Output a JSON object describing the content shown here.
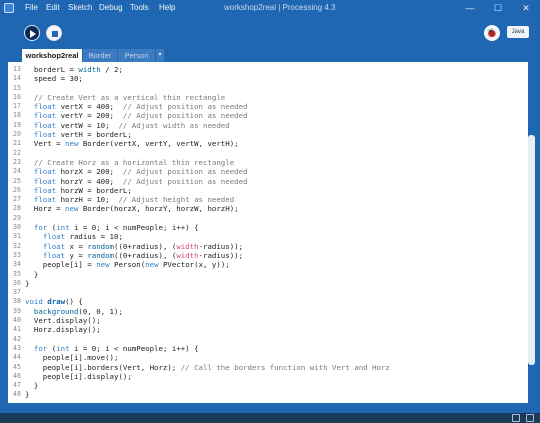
{
  "window": {
    "title": "workshop2real | Processing 4.3",
    "menu": [
      "File",
      "Edit",
      "Sketch",
      "Debug",
      "Tools",
      "Help"
    ],
    "controls": {
      "minimize": "—",
      "maximize": "☐",
      "close": "✕"
    }
  },
  "toolbar": {
    "mode": "Java",
    "debug_glyph": "🐞"
  },
  "tabs": [
    "workshop2real",
    "Border",
    "Person"
  ],
  "tab_menu_glyph": "▾",
  "editor": {
    "lines": [
      {
        "n": "13",
        "segs": [
          [
            "t",
            "  borderL = "
          ],
          [
            "f",
            "width"
          ],
          [
            "t",
            " / 2;"
          ]
        ]
      },
      {
        "n": "14",
        "segs": [
          [
            "t",
            "  speed = 30;"
          ]
        ]
      },
      {
        "n": "15",
        "segs": []
      },
      {
        "n": "16",
        "segs": [
          [
            "c",
            "  // Create Vert as a vertical thin rectangle"
          ]
        ]
      },
      {
        "n": "17",
        "segs": [
          [
            "t",
            "  "
          ],
          [
            "k",
            "float"
          ],
          [
            "t",
            " vertX = 400;  "
          ],
          [
            "c",
            "// Adjust position as needed"
          ]
        ]
      },
      {
        "n": "18",
        "segs": [
          [
            "t",
            "  "
          ],
          [
            "k",
            "float"
          ],
          [
            "t",
            " vertY = 200;  "
          ],
          [
            "c",
            "// Adjust position as needed"
          ]
        ]
      },
      {
        "n": "19",
        "segs": [
          [
            "t",
            "  "
          ],
          [
            "k",
            "float"
          ],
          [
            "t",
            " vertW = 10;  "
          ],
          [
            "c",
            "// Adjust width as needed"
          ]
        ]
      },
      {
        "n": "20",
        "segs": [
          [
            "t",
            "  "
          ],
          [
            "k",
            "float"
          ],
          [
            "t",
            " vertH = borderL;"
          ]
        ]
      },
      {
        "n": "21",
        "segs": [
          [
            "t",
            "  Vert = "
          ],
          [
            "k",
            "new"
          ],
          [
            "t",
            " Border(vertX, vertY, vertW, vertH);"
          ]
        ]
      },
      {
        "n": "22",
        "segs": []
      },
      {
        "n": "23",
        "segs": [
          [
            "c",
            "  // Create Horz as a horizontal thin rectangle"
          ]
        ]
      },
      {
        "n": "24",
        "segs": [
          [
            "t",
            "  "
          ],
          [
            "k",
            "float"
          ],
          [
            "t",
            " horzX = 200;  "
          ],
          [
            "c",
            "// Adjust position as needed"
          ]
        ]
      },
      {
        "n": "25",
        "segs": [
          [
            "t",
            "  "
          ],
          [
            "k",
            "float"
          ],
          [
            "t",
            " horzY = 400;  "
          ],
          [
            "c",
            "// Adjust position as needed"
          ]
        ]
      },
      {
        "n": "26",
        "segs": [
          [
            "t",
            "  "
          ],
          [
            "k",
            "float"
          ],
          [
            "t",
            " horzW = borderL;"
          ]
        ]
      },
      {
        "n": "27",
        "segs": [
          [
            "t",
            "  "
          ],
          [
            "k",
            "float"
          ],
          [
            "t",
            " horzH = 10;  "
          ],
          [
            "c",
            "// Adjust height as needed"
          ]
        ]
      },
      {
        "n": "28",
        "segs": [
          [
            "t",
            "  Horz = "
          ],
          [
            "k",
            "new"
          ],
          [
            "t",
            " Border(horzX, horzY, horzW, horzH);"
          ]
        ]
      },
      {
        "n": "29",
        "segs": []
      },
      {
        "n": "30",
        "segs": [
          [
            "t",
            "  "
          ],
          [
            "k",
            "for"
          ],
          [
            "t",
            " ("
          ],
          [
            "k",
            "int"
          ],
          [
            "t",
            " i = 0; i < numPeople; i++) {"
          ]
        ]
      },
      {
        "n": "31",
        "segs": [
          [
            "t",
            "    "
          ],
          [
            "k",
            "float"
          ],
          [
            "t",
            " radius = 10;"
          ]
        ]
      },
      {
        "n": "32",
        "segs": [
          [
            "t",
            "    "
          ],
          [
            "k",
            "float"
          ],
          [
            "t",
            " x = "
          ],
          [
            "f",
            "random"
          ],
          [
            "t",
            "((0+radius), ("
          ],
          [
            "v",
            "width"
          ],
          [
            "t",
            "-radius));"
          ]
        ]
      },
      {
        "n": "33",
        "segs": [
          [
            "t",
            "    "
          ],
          [
            "k",
            "float"
          ],
          [
            "t",
            " y = "
          ],
          [
            "f",
            "random"
          ],
          [
            "t",
            "((0+radius), ("
          ],
          [
            "v",
            "width"
          ],
          [
            "t",
            "-radius));"
          ]
        ]
      },
      {
        "n": "34",
        "segs": [
          [
            "t",
            "    people[i] = "
          ],
          [
            "k",
            "new"
          ],
          [
            "t",
            " Person("
          ],
          [
            "k",
            "new"
          ],
          [
            "t",
            " PVector(x, y));"
          ]
        ]
      },
      {
        "n": "35",
        "segs": [
          [
            "t",
            "  }"
          ]
        ]
      },
      {
        "n": "36",
        "segs": [
          [
            "t",
            "}"
          ]
        ]
      },
      {
        "n": "37",
        "segs": []
      },
      {
        "n": "38",
        "segs": [
          [
            "k",
            "void"
          ],
          [
            "t",
            " "
          ],
          [
            "b",
            "draw"
          ],
          [
            "t",
            "() {"
          ]
        ]
      },
      {
        "n": "39",
        "segs": [
          [
            "t",
            "  "
          ],
          [
            "f",
            "background"
          ],
          [
            "t",
            "(0, 0, 1);"
          ]
        ]
      },
      {
        "n": "40",
        "segs": [
          [
            "t",
            "  Vert.display();"
          ]
        ]
      },
      {
        "n": "41",
        "segs": [
          [
            "t",
            "  Horz.display();"
          ]
        ]
      },
      {
        "n": "42",
        "segs": []
      },
      {
        "n": "43",
        "segs": [
          [
            "t",
            "  "
          ],
          [
            "k",
            "for"
          ],
          [
            "t",
            " ("
          ],
          [
            "k",
            "int"
          ],
          [
            "t",
            " i = 0; i < numPeople; i++) {"
          ]
        ]
      },
      {
        "n": "44",
        "segs": [
          [
            "t",
            "    people[i].move();"
          ]
        ]
      },
      {
        "n": "45",
        "segs": [
          [
            "t",
            "    people[i].borders(Vert, Horz); "
          ],
          [
            "c",
            "// Call the borders function with Vert and Horz"
          ]
        ]
      },
      {
        "n": "46",
        "segs": [
          [
            "t",
            "    people[i].display();"
          ]
        ]
      },
      {
        "n": "47",
        "segs": [
          [
            "t",
            "  }"
          ]
        ]
      },
      {
        "n": "48",
        "segs": [
          [
            "t",
            "}"
          ]
        ]
      }
    ]
  }
}
